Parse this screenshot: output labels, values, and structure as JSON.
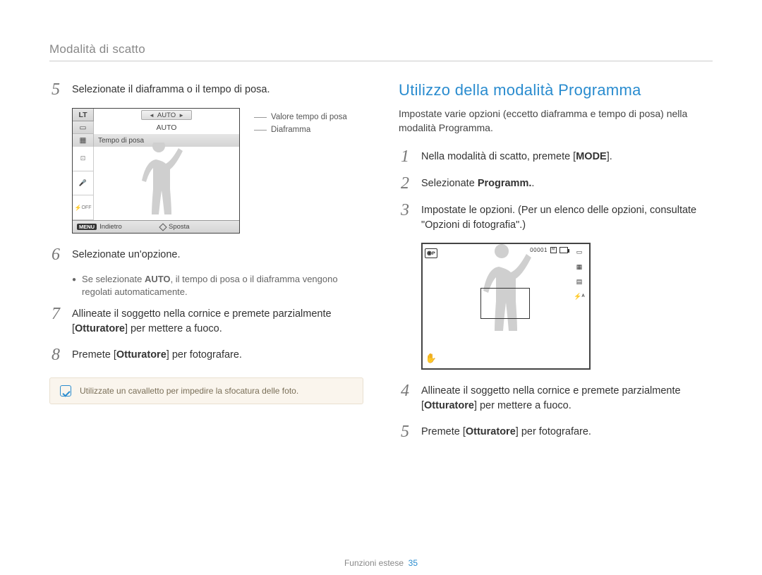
{
  "breadcrumb": "Modalità di scatto",
  "left": {
    "step5": "Selezionate il diaframma o il tempo di posa.",
    "lcd": {
      "badge": "LT",
      "auto1": "AUTO",
      "auto2": "AUTO",
      "tempo": "Tempo di posa",
      "menu": "MENU",
      "indietro": "Indietro",
      "sposta": "Sposta"
    },
    "callout1": "Valore tempo di posa",
    "callout2": "Diaframma",
    "step6": "Selezionate un'opzione.",
    "step6_sub_prefix": "Se selezionate ",
    "step6_sub_bold": "AUTO",
    "step6_sub_suffix": ", il tempo di posa o il diaframma vengono regolati automaticamente.",
    "step7_a": "Allineate il soggetto nella cornice e premete parzialmente [",
    "step7_b": "Otturatore",
    "step7_c": "] per mettere a fuoco.",
    "step8_a": "Premete [",
    "step8_b": "Otturatore",
    "step8_c": "] per fotografare.",
    "note": "Utilizzate un cavalletto per impedire la sfocatura delle foto."
  },
  "right": {
    "heading": "Utilizzo della modalità Programma",
    "lead": "Impostate varie opzioni (eccetto diaframma e tempo di posa) nella modalità Programma.",
    "step1_a": "Nella modalità di scatto, premete [",
    "step1_b": "MODE",
    "step1_c": "].",
    "step2_a": "Selezionate ",
    "step2_b": "Programm.",
    "step2_c": ".",
    "step3": "Impostate le opzioni. (Per un elenco delle opzioni, consultate \"Opzioni di fotografia\".)",
    "lcd2": {
      "modebadge_glyph": "◉ᴘ",
      "counter": "00001",
      "flash": "⚡ᴬ"
    },
    "step4_a": "Allineate il soggetto nella cornice e premete parzialmente [",
    "step4_b": "Otturatore",
    "step4_c": "] per mettere a fuoco.",
    "step5_a": "Premete [",
    "step5_b": "Otturatore",
    "step5_c": "] per fotografare."
  },
  "footer": {
    "label": "Funzioni estese",
    "page": "35"
  }
}
